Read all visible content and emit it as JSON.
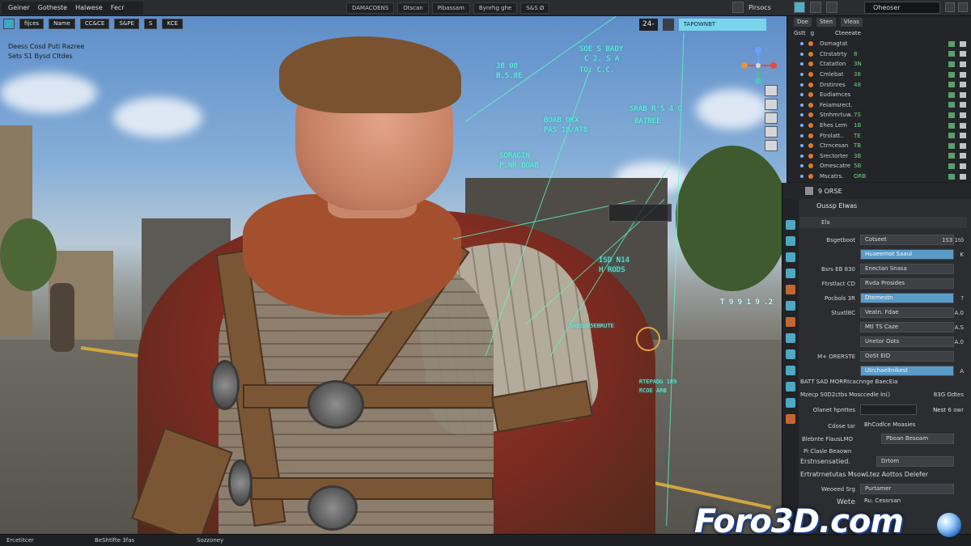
{
  "menubar": {
    "items": [
      "Geiner",
      "Gotheste",
      "Halwese",
      "Fecr"
    ],
    "center_tabs": [
      "DAMACOENS",
      "Otscan",
      "Pibassam",
      "Bynrhg ghe",
      "S&S Ø"
    ],
    "right_tool_label": "Pirsocs",
    "right_labels": [
      "Doe",
      "Sten",
      "Vleas"
    ],
    "search_value": "Oheoser"
  },
  "viewport": {
    "tl_chips": [
      "fijces",
      "Name",
      "CC&CE",
      "S&PE",
      "S",
      "KCE"
    ],
    "info_line1": "Deess Cosd Puti Razree",
    "info_line2": "Sets S1 Bysd Cltdes",
    "tr_num": "24-",
    "tr_bar": "TAPOWNBT",
    "holo_labels": [
      "SOE S BADY",
      "C 2. S A",
      "TO. C.C.",
      "38 08",
      "B.S.8E",
      "BOAB OKX",
      "PAS 18/AT8",
      "SRAB R'S 4 O",
      "BATREE",
      "SORAGIN",
      "P.NR BOAB",
      "ISD N14",
      "H RODS",
      "T 9 9 1 9 .2",
      "5ABS9B5EBRUTE",
      "RTEPADG 189",
      "RCOE ARB"
    ]
  },
  "outliner": {
    "head": [
      "Gstt",
      "g",
      "Cteeeate"
    ],
    "rows": [
      {
        "label": "Osmagtat",
        "code": ""
      },
      {
        "label": "Ctrstatrty",
        "code": "8"
      },
      {
        "label": "Ctatatlon",
        "code": "3N"
      },
      {
        "label": "Cmlebat",
        "code": "38"
      },
      {
        "label": "Drstinres",
        "code": "48"
      },
      {
        "label": "Eudiamces",
        "code": ""
      },
      {
        "label": "Feiamsrect.",
        "code": ""
      },
      {
        "label": "Stnhmrtuw.",
        "code": "7S"
      },
      {
        "label": "Ehes Lem",
        "code": "1B"
      },
      {
        "label": "Ftrolatt..",
        "code": "TE"
      },
      {
        "label": "Ctrncesan",
        "code": "TB"
      },
      {
        "label": "Srectorter",
        "code": "3B"
      },
      {
        "label": "Omescatre",
        "code": "5B"
      },
      {
        "label": "Mscatrs.",
        "code": "ORB"
      }
    ]
  },
  "properties": {
    "header": "9 ORSE",
    "sub1": "Oussp Elwas",
    "sub2": "Ela",
    "rows": [
      {
        "label": "Bsgetboot",
        "value": "Cotseet",
        "num": "1S3 1tö",
        "blue": false
      },
      {
        "label": "",
        "value": "Huaeemot Saaul",
        "num": "K",
        "blue": true
      },
      {
        "label": "Bsrs EB 830",
        "value": "Enectan Snasa",
        "num": "",
        "blue": false
      },
      {
        "label": "Ftrstlact CD",
        "value": "Rvda Prosides",
        "num": "",
        "blue": false
      },
      {
        "label": "Pocbols 3R",
        "value": "Dtemestn",
        "num": "?",
        "blue": true
      },
      {
        "label": "Stuxtl8C",
        "value": "Veatn. Fdae",
        "num": "A.0",
        "blue": false
      },
      {
        "label": "",
        "value": "Mtl TS Caze",
        "num": "A.S",
        "blue": false
      },
      {
        "label": "",
        "value": "Unetor Oots",
        "num": "A.0",
        "blue": false
      },
      {
        "label": "M+ ORERSTE",
        "value": "OoSt EID",
        "num": "",
        "blue": false
      },
      {
        "label": "",
        "value": "Utrchaeltnikest",
        "num": "A",
        "blue": true
      }
    ],
    "wide1": "BATT SAD MORRtcacnnge BaecEia",
    "wide2_left": "Mzecp S0D2ctbs Mosccedle ln()",
    "wide2_right": "83G Odtes",
    "row_obj_label": "Olanet hpnttes",
    "row_obj_num": "Nest",
    "row_obj_num2": "6 owr",
    "row_q_label": "Cdose tar",
    "row_q_value": "BhCodlce Moasies",
    "row_r_label": "Blebnte FlausLMO",
    "row_r_value": "Pboan Besoam",
    "row_s_label": "Pi Clasle Beaown",
    "wide3_label": "Erstnsensatied.",
    "wide3_value": "Drtom",
    "wide4": "Ertratrnetutas MsowLtez Aottos Delefer",
    "row_t_label": "Weoeed Srg",
    "row_t_value": "Purtamer",
    "row_u_label": "Wete",
    "row_u_value": "Ru. Cessrsan"
  },
  "statusbar": {
    "left": "Ercetitcer",
    "mid": "BeShtlfte 3fas",
    "right": "Sozzoney"
  },
  "watermark": "Foro3D.com",
  "colors": {
    "accent": "#4fb0c6",
    "holo": "#6ff2d7",
    "field_blue": "#5b9bc7",
    "panel_bg": "#2b2d31"
  },
  "icons": [
    "search-icon",
    "gizmo-axis-icon",
    "eye-icon",
    "camera-icon",
    "render-icon",
    "material-icon",
    "modifier-icon"
  ]
}
